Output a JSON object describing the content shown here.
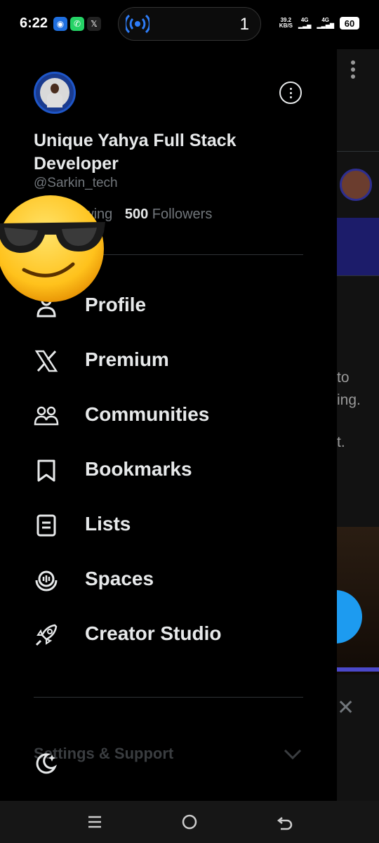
{
  "status": {
    "time": "6:22",
    "live_count": "1",
    "net_speed_top": "39.2",
    "net_speed_unit": "KB/S",
    "net1": "4G",
    "net2": "4G",
    "battery": "60"
  },
  "profile": {
    "name": "Unique Yahya Full Stack Developer",
    "handle": "@Sarkin_tech",
    "following_label": "owing",
    "followers_count": "500",
    "followers_label": "Followers"
  },
  "menu": [
    {
      "label": "Profile",
      "icon": "person-icon"
    },
    {
      "label": "Premium",
      "icon": "x-logo-icon"
    },
    {
      "label": "Communities",
      "icon": "communities-icon"
    },
    {
      "label": "Bookmarks",
      "icon": "bookmark-icon"
    },
    {
      "label": "Lists",
      "icon": "list-icon"
    },
    {
      "label": "Spaces",
      "icon": "spaces-icon"
    },
    {
      "label": "Creator Studio",
      "icon": "rocket-icon"
    }
  ],
  "settings": {
    "label": "Settings & Support"
  },
  "feed_peek": {
    "t1": "to",
    "t2": "ing.",
    "t3": "t."
  },
  "colors": {
    "accent": "#1d9bf0",
    "text": "#e7e9ea",
    "muted": "#71767b",
    "divider": "#2f3336"
  }
}
